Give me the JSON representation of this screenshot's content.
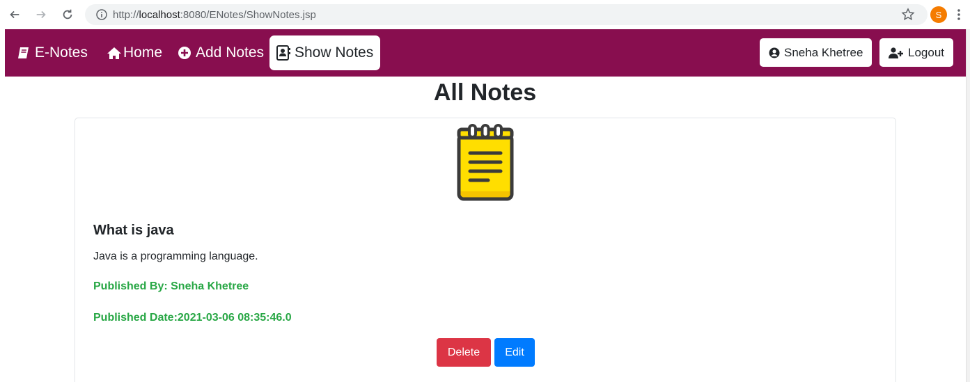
{
  "browser": {
    "url_prefix": "http://",
    "url_host": "localhost",
    "url_rest": ":8080/ENotes/ShowNotes.jsp",
    "profile_initial": "S"
  },
  "navbar": {
    "brand": "E-Notes",
    "items": [
      {
        "label": "Home"
      },
      {
        "label": "Add Notes"
      },
      {
        "label": "Show Notes",
        "active": true
      }
    ],
    "user_label": "Sneha Khetree",
    "logout_label": "Logout",
    "background_color": "#880e4f"
  },
  "main": {
    "title": "All Notes",
    "notes": [
      {
        "title": "What is java",
        "content": "Java is a programming language.",
        "published_by": "Published By: Sneha Khetree",
        "published_date": "Published Date:2021-03-06 08:35:46.0",
        "delete_label": "Delete",
        "edit_label": "Edit"
      }
    ]
  },
  "colors": {
    "accent_green": "#28a745",
    "delete_red": "#dc3545",
    "edit_blue": "#007bff"
  },
  "icons": {
    "brand": "book-icon",
    "home": "home-icon",
    "add": "plus-circle-icon",
    "show": "address-book-icon",
    "user": "user-circle-icon",
    "logout": "user-plus-icon",
    "note": "notepad-icon"
  }
}
